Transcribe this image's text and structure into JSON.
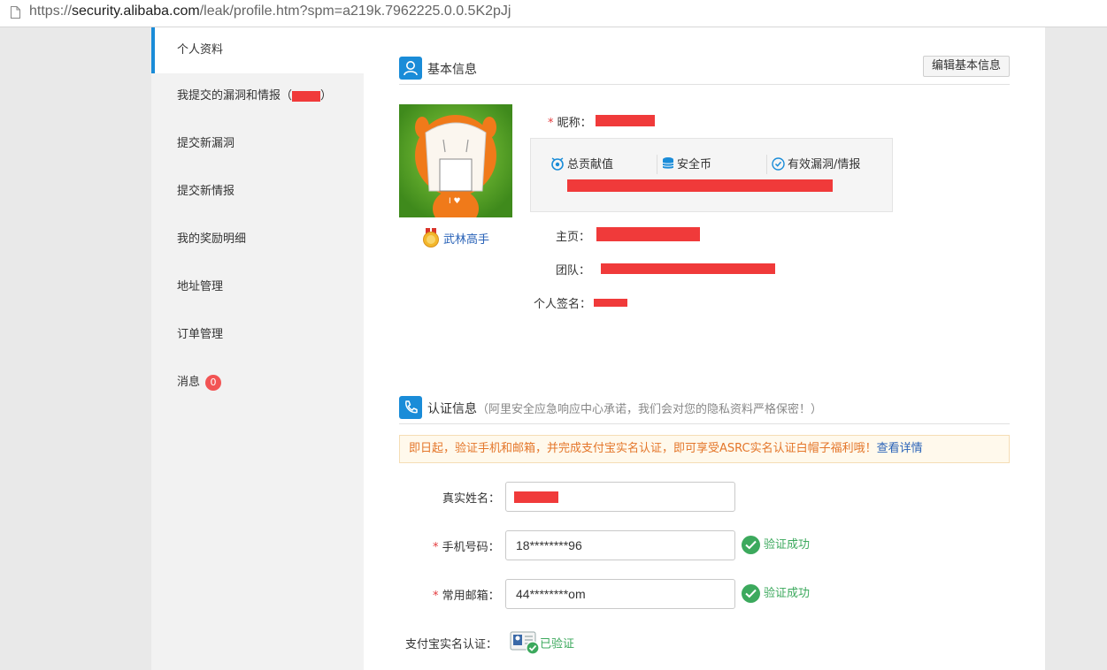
{
  "browser": {
    "url_prefix": "https://",
    "url_host": "security.alibaba.com",
    "url_path": "/leak/profile.htm?spm=a219k.7962225.0.0.5K2pJj"
  },
  "sidebar": {
    "items": [
      {
        "label": "个人资料"
      },
      {
        "label": "我提交的漏洞和情报（",
        "suffix": "）"
      },
      {
        "label": "提交新漏洞"
      },
      {
        "label": "提交新情报"
      },
      {
        "label": "我的奖励明细"
      },
      {
        "label": "地址管理"
      },
      {
        "label": "订单管理"
      },
      {
        "label": "消息",
        "badge": "0"
      }
    ]
  },
  "basic": {
    "title": "基本信息",
    "edit_button": "编辑基本信息",
    "rank_label": "武林高手",
    "nickname_label": "昵称：",
    "required_mark": "*",
    "stats": {
      "contribution": "总贡献值",
      "coins": "安全币",
      "valid": "有效漏洞/情报"
    },
    "homepage_label": "主页：",
    "team_label": "团队：",
    "signature_label": "个人签名："
  },
  "auth": {
    "title": "认证信息",
    "note": "（阿里安全应急响应中心承诺，我们会对您的隐私资料严格保密！）",
    "notice_text": "即日起，验证手机和邮箱，并完成支付宝实名认证，即可享受ASRC实名认证白帽子福利哦！",
    "notice_link": "查看详情",
    "realname_label": "真实姓名：",
    "phone_label": "手机号码：",
    "phone_value": "18********96",
    "phone_status": "验证成功",
    "email_label": "常用邮箱：",
    "email_value": "44********om",
    "email_status": "验证成功",
    "alipay_label": "支付宝实名认证：",
    "alipay_status": "已验证"
  },
  "colors": {
    "accent": "#1a8cd8",
    "redaction": "#f03a3a",
    "success": "#3ca95d",
    "notice_text": "#e4762a"
  }
}
